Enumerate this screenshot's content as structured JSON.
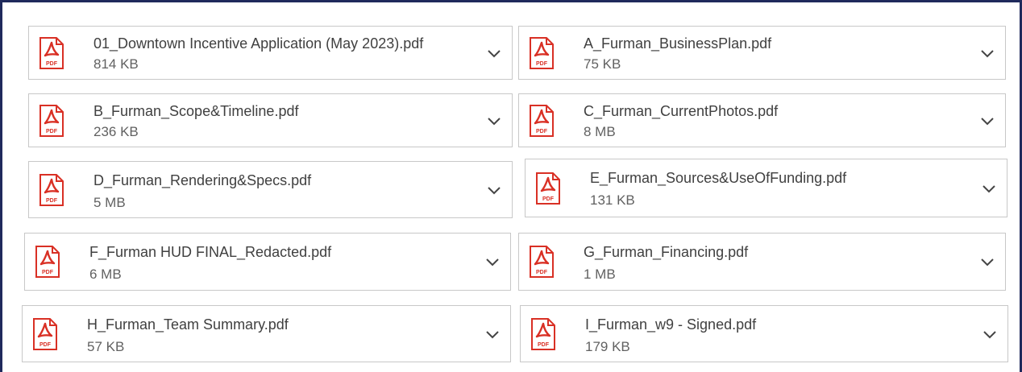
{
  "attachments": [
    {
      "name": "01_Downtown Incentive Application (May 2023).pdf",
      "size": "814 KB",
      "icon": "pdf-file-icon",
      "icon_label": "PDF"
    },
    {
      "name": "A_Furman_BusinessPlan.pdf",
      "size": "75 KB",
      "icon": "pdf-file-icon",
      "icon_label": "PDF"
    },
    {
      "name": "B_Furman_Scope&Timeline.pdf",
      "size": "236 KB",
      "icon": "pdf-file-icon",
      "icon_label": "PDF"
    },
    {
      "name": "C_Furman_CurrentPhotos.pdf",
      "size": "8 MB",
      "icon": "pdf-file-icon",
      "icon_label": "PDF"
    },
    {
      "name": "D_Furman_Rendering&Specs.pdf",
      "size": "5 MB",
      "icon": "pdf-file-icon",
      "icon_label": "PDF"
    },
    {
      "name": "E_Furman_Sources&UseOfFunding.pdf",
      "size": "131 KB",
      "icon": "pdf-file-icon",
      "icon_label": "PDF"
    },
    {
      "name": "F_Furman HUD FINAL_Redacted.pdf",
      "size": "6 MB",
      "icon": "pdf-file-icon",
      "icon_label": "PDF"
    },
    {
      "name": "G_Furman_Financing.pdf",
      "size": "1 MB",
      "icon": "pdf-file-icon",
      "icon_label": "PDF"
    },
    {
      "name": "H_Furman_Team Summary.pdf",
      "size": "57 KB",
      "icon": "pdf-file-icon",
      "icon_label": "PDF"
    },
    {
      "name": "I_Furman_w9 - Signed.pdf",
      "size": "179 KB",
      "icon": "pdf-file-icon",
      "icon_label": "PDF"
    }
  ],
  "colors": {
    "frame_border": "#1f2a5c",
    "pdf_red": "#d93025",
    "card_border": "#c8c8c8",
    "text_primary": "#404040",
    "text_secondary": "#616161"
  }
}
